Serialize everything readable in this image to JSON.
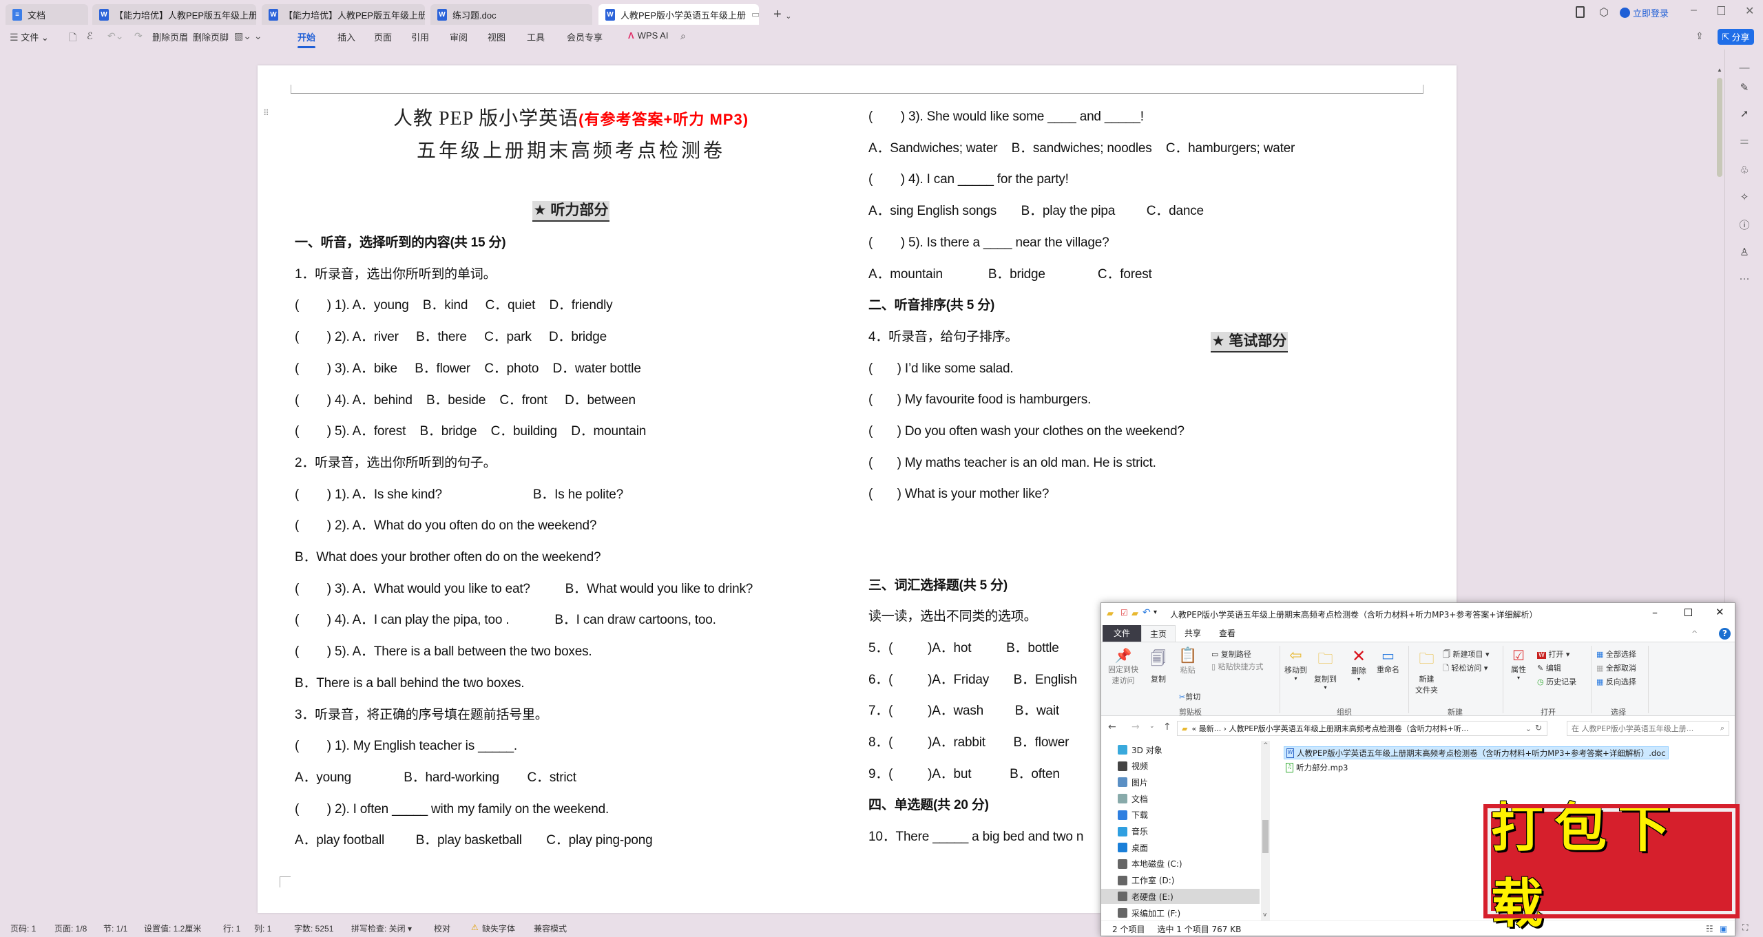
{
  "tabs": [
    {
      "label": "文档",
      "icon": "doc-icon"
    },
    {
      "label": "【能力培优】人教PEP版五年级上册英",
      "icon": "word-icon"
    },
    {
      "label": "【能力培优】人教PEP版五年级上册英",
      "icon": "word-icon"
    },
    {
      "label": "练习题.doc",
      "icon": "word-icon"
    },
    {
      "label": "人教PEP版小学英语五年级上册",
      "icon": "word-icon",
      "active": true
    }
  ],
  "window": {
    "login": "立即登录",
    "share": "分享"
  },
  "toolbar": {
    "file": "文件",
    "delete_header": "删除页眉",
    "delete_footer": "删除页脚",
    "menus": [
      "开始",
      "插入",
      "页面",
      "引用",
      "审阅",
      "视图",
      "工具",
      "会员专享"
    ],
    "active_menu": "开始",
    "wps_ai": "WPS AI"
  },
  "document": {
    "title": "人教 PEP 版小学英语",
    "title_note": "(有参考答案+听力 MP3)",
    "title_note_color": "#ff0000",
    "subtitle": "五年级上册期末高频考点检测卷",
    "section_listening": "★  听力部分",
    "section_writing": "★  笔试部分",
    "left_lines": [
      {
        "t": "一、听音，选择听到的内容(共 15 分)",
        "b": true
      },
      {
        "t": "1．听录音，选出你所听到的单词。"
      },
      {
        "t": "(        ) 1). A．young    B．kind     C．quiet    D．friendly"
      },
      {
        "t": "(        ) 2). A．river     B．there     C．park     D．bridge"
      },
      {
        "t": "(        ) 3). A．bike     B．flower    C．photo    D．water bottle"
      },
      {
        "t": "(        ) 4). A．behind    B．beside    C．front     D．between"
      },
      {
        "t": "(        ) 5). A．forest    B．bridge    C．building    D．mountain"
      },
      {
        "t": "2．听录音，选出你所听到的句子。"
      },
      {
        "t": "(        ) 1). A．Is she kind?                          B．Is he polite?"
      },
      {
        "t": "(        ) 2). A．What do you often do on the weekend?"
      },
      {
        "t": "B．What does your brother often do on the weekend?"
      },
      {
        "t": "(        ) 3). A．What would you like to eat?          B．What would you like to drink?"
      },
      {
        "t": "(        ) 4). A．I can play the pipa, too .             B．I can draw cartoons, too."
      },
      {
        "t": "(        ) 5). A．There is a ball between the two boxes."
      },
      {
        "t": "B．There is a ball behind the two boxes."
      },
      {
        "t": "3．听录音，将正确的序号填在题前括号里。"
      },
      {
        "t": "(        ) 1). My English teacher is _____."
      },
      {
        "t": "A．young               B．hard-working        C．strict"
      },
      {
        "t": "(        ) 2). I often _____ with my family on the weekend."
      },
      {
        "t": "A．play football         B．play basketball       C．play ping-pong"
      }
    ],
    "right_lines_a": [
      {
        "t": "(        ) 3). She would like some ____ and _____!"
      },
      {
        "t": "A．Sandwiches; water    B．sandwiches; noodles    C．hamburgers; water"
      },
      {
        "t": "(        ) 4). I can _____ for the party!"
      },
      {
        "t": "A．sing English songs       B．play the pipa         C．dance"
      },
      {
        "t": "(        ) 5). Is there a ____ near the village?"
      },
      {
        "t": "A．mountain             B．bridge               C．forest"
      },
      {
        "t": "二、听音排序(共 5 分)",
        "b": true
      },
      {
        "t": "4．听录音，给句子排序。"
      },
      {
        "t": "(       ) I’d like some salad."
      },
      {
        "t": "(       ) My favourite food is hamburgers."
      },
      {
        "t": "(       ) Do you often wash your clothes on the weekend?"
      },
      {
        "t": "(       ) My maths teacher is an old man. He is strict."
      },
      {
        "t": "(       ) What is your mother like?"
      }
    ],
    "right_lines_b": [
      {
        "t": "三、词汇选择题(共 5 分)",
        "b": true
      },
      {
        "t": "读一读，选出不同类的选项。"
      },
      {
        "t": "5．(          )A．hot          B．bottle"
      },
      {
        "t": "6．(          )A．Friday       B．English"
      },
      {
        "t": "7．(          )A．wash         B．wait"
      },
      {
        "t": "8．(          )A．rabbit        B．flower"
      },
      {
        "t": "9．(          )A．but           B．often"
      },
      {
        "t": "四、单选题(共 20 分)",
        "b": true
      },
      {
        "t": "10．There _____ a big bed and two n"
      }
    ]
  },
  "statusbar": {
    "page_code": "页码: 1",
    "pages": "页面: 1/8",
    "section": "节: 1/1",
    "setting": "设置值: 1.2厘米",
    "row": "行: 1",
    "col": "列: 1",
    "word_count": "字数: 5251",
    "spell": "拼写检查: 关闭 ▾",
    "proof": "校对",
    "missing_font": "缺失字体",
    "compat": "兼容模式"
  },
  "explorer": {
    "title": "人教PEP版小学英语五年级上册期末高频考点检测卷（含听力材料+听力MP3+参考答案+详细解析）",
    "tabs": [
      "文件",
      "主页",
      "共享",
      "查看"
    ],
    "ribbon": {
      "pin": [
        "固定到快",
        "速访问"
      ],
      "copy": "复制",
      "paste": "粘贴",
      "copy_path": "复制路径",
      "paste_shortcut": "粘贴快捷方式",
      "cut": "剪切",
      "move_to": "移动到",
      "copy_to": "复制到",
      "delete": "删除",
      "rename": "重命名",
      "new_folder": [
        "新建",
        "文件夹"
      ],
      "new_item": "新建项目 ▾",
      "easy_access": "轻松访问 ▾",
      "properties": "属性",
      "open": "打开 ▾",
      "edit": "编辑",
      "history": "历史记录",
      "select_all": "全部选择",
      "select_none": "全部取消",
      "invert": "反向选择",
      "groups": [
        "剪贴板",
        "组织",
        "新建",
        "打开",
        "选择"
      ]
    },
    "address": "«  最新...  ›   人教PEP版小学英语五年级上册期末高频考点检测卷（含听力材料+听...",
    "search_placeholder": "在 人教PEP版小学英语五年级上册...",
    "nav": [
      {
        "label": "3D 对象",
        "icon": "cube-icon",
        "color": "#39a9dc"
      },
      {
        "label": "视频",
        "icon": "video-icon",
        "color": "#444"
      },
      {
        "label": "图片",
        "icon": "picture-icon",
        "color": "#5a8fc4"
      },
      {
        "label": "文档",
        "icon": "document-icon",
        "color": "#8aa"
      },
      {
        "label": "下载",
        "icon": "download-icon",
        "color": "#2f7fe0"
      },
      {
        "label": "音乐",
        "icon": "music-icon",
        "color": "#2f9fe0"
      },
      {
        "label": "桌面",
        "icon": "desktop-icon",
        "color": "#1a7fd8"
      },
      {
        "label": "本地磁盘 (C:)",
        "icon": "drive-icon",
        "color": "#666"
      },
      {
        "label": "工作室 (D:)",
        "icon": "drive-icon",
        "color": "#666"
      },
      {
        "label": "老硬盘 (E:)",
        "icon": "drive-icon",
        "color": "#666",
        "selected": true
      },
      {
        "label": "采编加工 (F:)",
        "icon": "drive-icon",
        "color": "#666"
      }
    ],
    "files": [
      {
        "name": "人教PEP版小学英语五年级上册期末高频考点检测卷（含听力材料+听力MP3+参考答案+详细解析）.doc",
        "icon": "word-file-icon",
        "selected": true
      },
      {
        "name": "听力部分.mp3",
        "icon": "audio-file-icon"
      }
    ],
    "status_count": "2 个项目",
    "status_selected": "选中 1 个项目  767 KB"
  },
  "stamp": {
    "text": "打包下载"
  }
}
